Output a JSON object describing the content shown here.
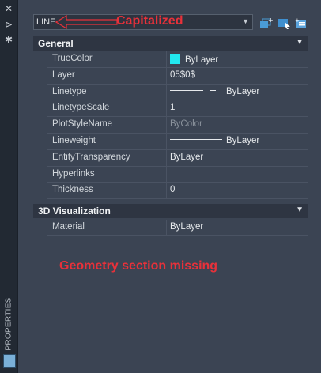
{
  "rail": {
    "close_icon": "close-icon",
    "pin_icon": "pin-icon",
    "settings_icon": "gear-icon",
    "label": "PROPERTIES"
  },
  "toolbar": {
    "object_type": "LINE",
    "annotation": "Capitalized",
    "icons": [
      "quick-select-icon",
      "select-objects-icon",
      "toggle-pickadd-icon"
    ]
  },
  "sections": {
    "general": {
      "title": "General",
      "rows": [
        {
          "key": "TrueColor",
          "value": "ByLayer",
          "swatch": "#22e8f0"
        },
        {
          "key": "Layer",
          "value": "05$0$"
        },
        {
          "key": "Linetype",
          "value": "ByLayer"
        },
        {
          "key": "LinetypeScale",
          "value": "1"
        },
        {
          "key": "PlotStyleName",
          "value": "ByColor"
        },
        {
          "key": "Lineweight",
          "value": "ByLayer"
        },
        {
          "key": "EntityTransparency",
          "value": "ByLayer"
        },
        {
          "key": "Hyperlinks",
          "value": ""
        },
        {
          "key": "Thickness",
          "value": "0"
        }
      ]
    },
    "visualization": {
      "title": "3D Visualization",
      "rows": [
        {
          "key": "Material",
          "value": "ByLayer"
        }
      ]
    }
  },
  "note": "Geometry section missing",
  "colors": {
    "annotation_red": "#e8313a",
    "panel_bg": "#3b4453",
    "header_bg": "#2e3542"
  }
}
